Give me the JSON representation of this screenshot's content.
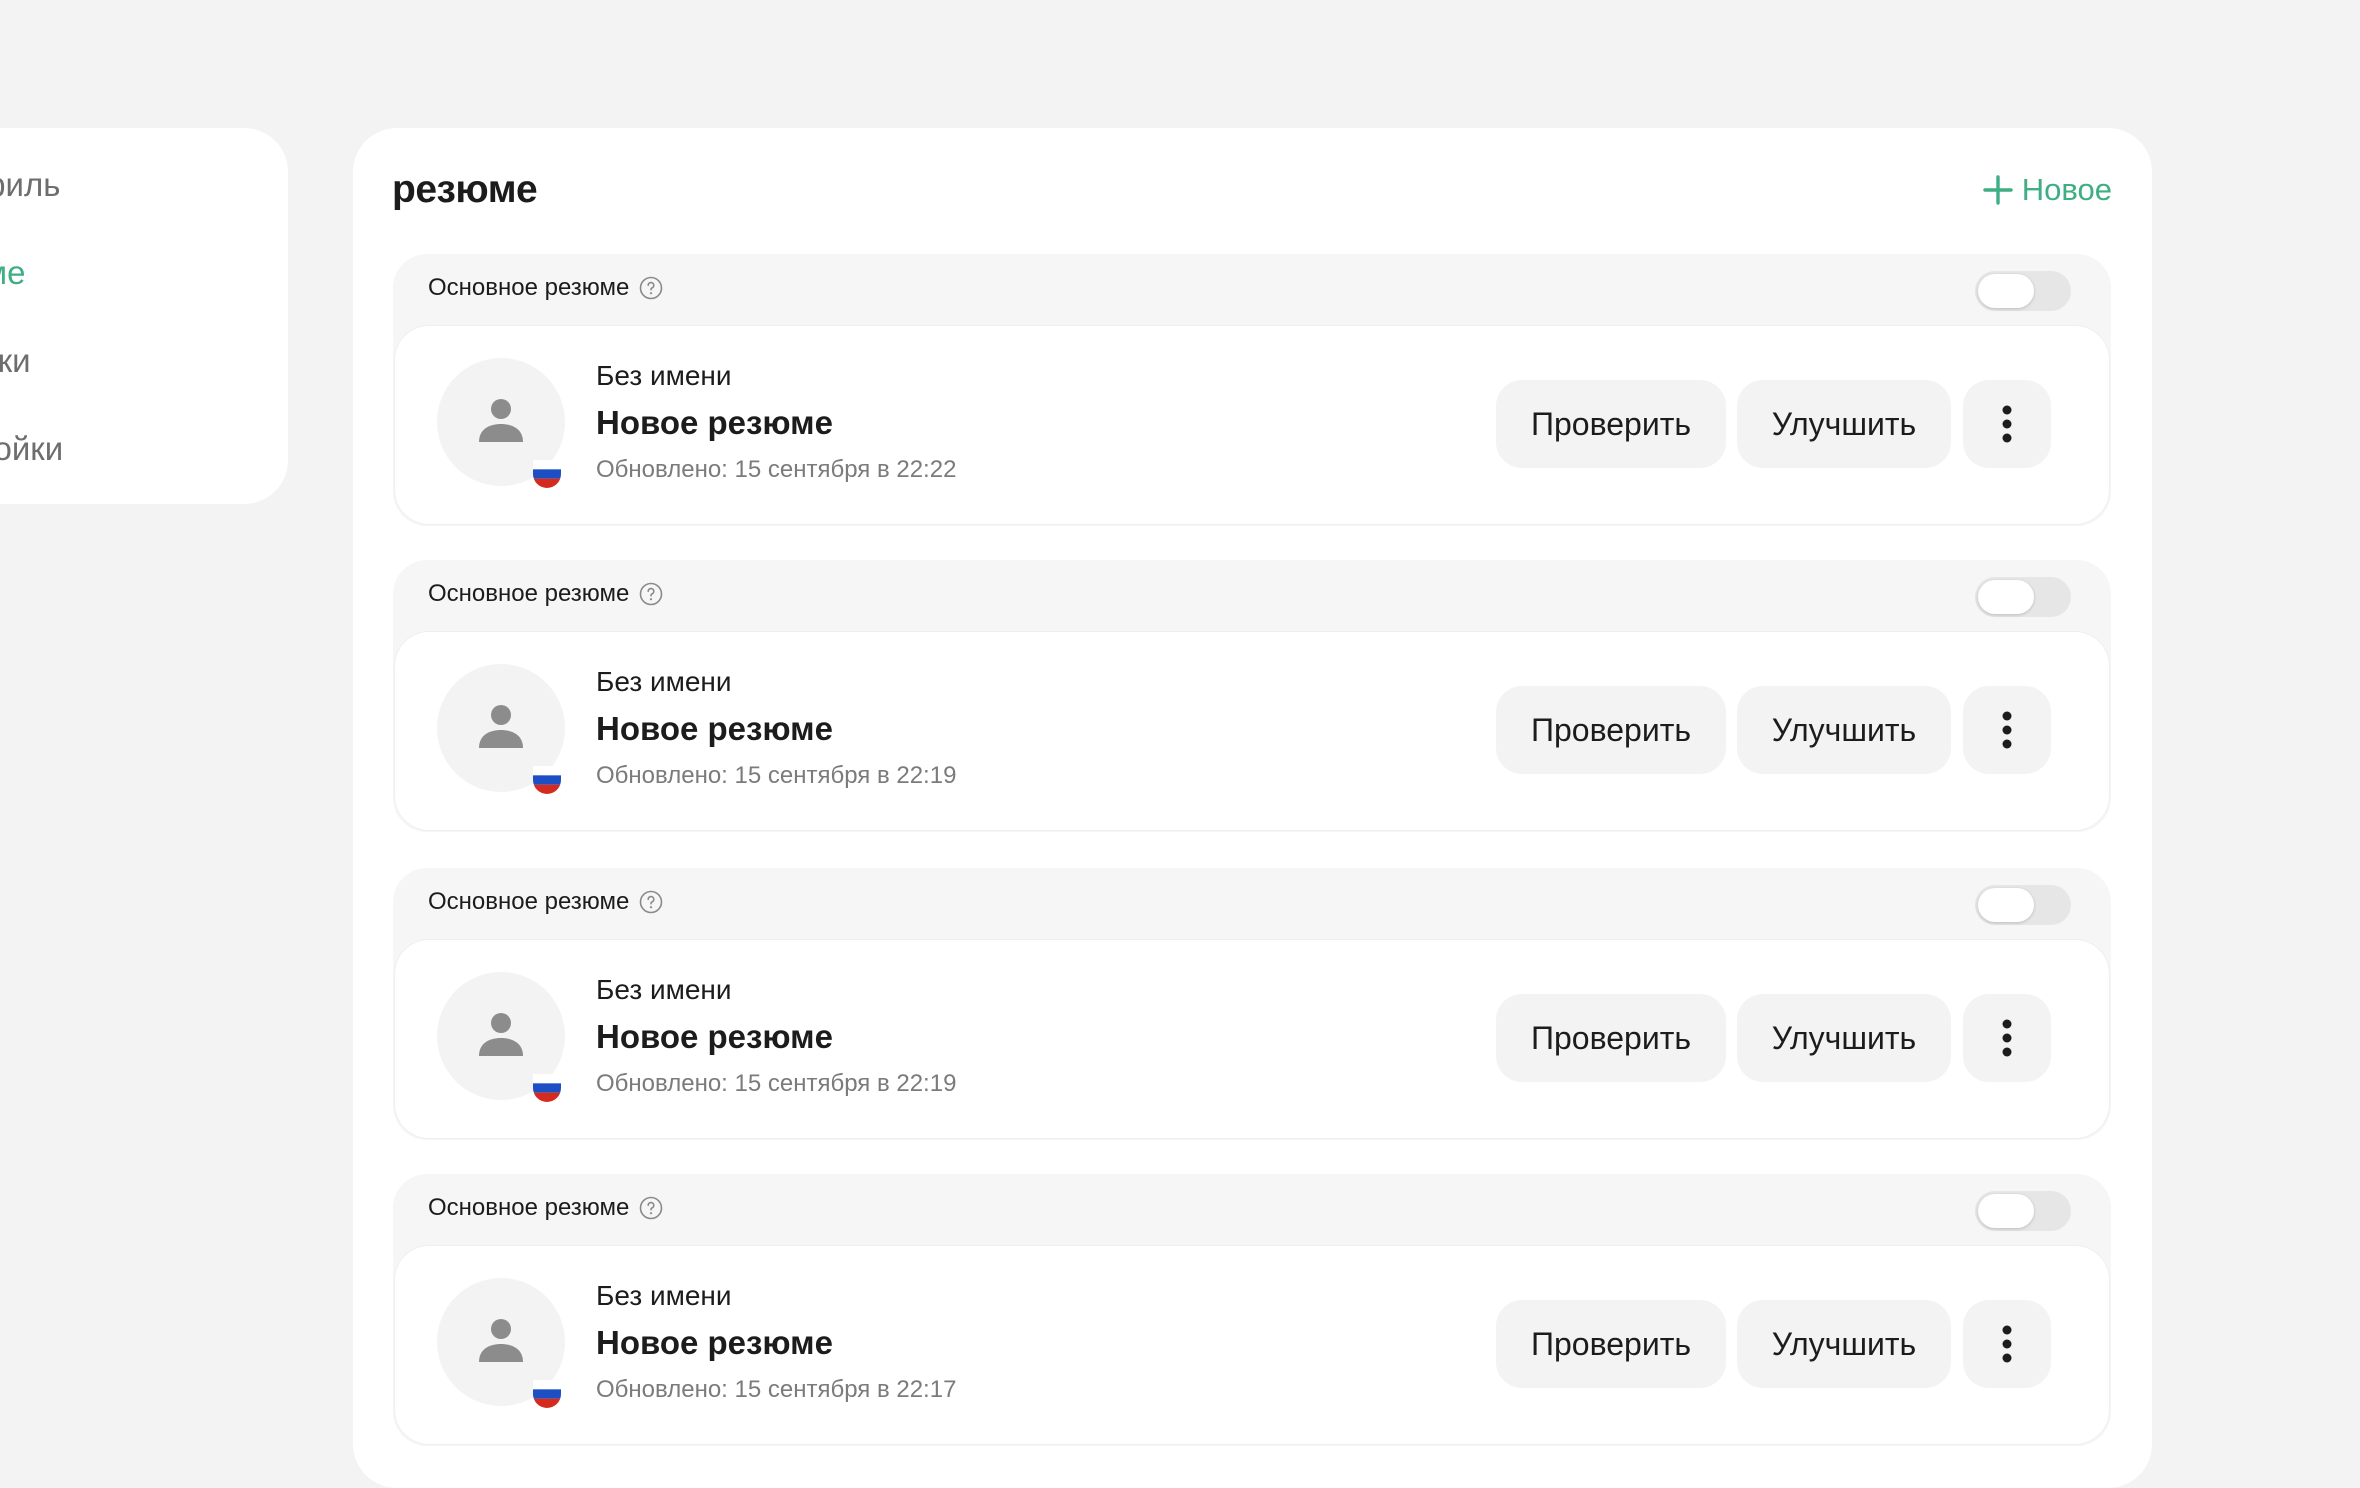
{
  "sidebar": {
    "items": [
      {
        "label": "офиль",
        "active": false
      },
      {
        "label": "юме",
        "active": true
      },
      {
        "label": "лики",
        "active": false
      },
      {
        "label": "тройки",
        "active": false
      }
    ]
  },
  "panel": {
    "title": "резюме",
    "new_label": "Новое"
  },
  "colors": {
    "accent": "#3fae84",
    "text": "#1c1c1c",
    "muted": "#7b7b7b"
  },
  "resumes": [
    {
      "primary_label": "Основное резюме",
      "name": "Без имени",
      "title": "Новое резюме",
      "updated": "Обновлено: 15 сентября в 22:22",
      "check_label": "Проверить",
      "improve_label": "Улучшить"
    },
    {
      "primary_label": "Основное резюме",
      "name": "Без имени",
      "title": "Новое резюме",
      "updated": "Обновлено: 15 сентября в 22:19",
      "check_label": "Проверить",
      "improve_label": "Улучшить"
    },
    {
      "primary_label": "Основное резюме",
      "name": "Без имени",
      "title": "Новое резюме",
      "updated": "Обновлено: 15 сентября в 22:19",
      "check_label": "Проверить",
      "improve_label": "Улучшить"
    },
    {
      "primary_label": "Основное резюме",
      "name": "Без имени",
      "title": "Новое резюме",
      "updated": "Обновлено: 15 сентября в 22:17",
      "check_label": "Проверить",
      "improve_label": "Улучшить"
    }
  ]
}
